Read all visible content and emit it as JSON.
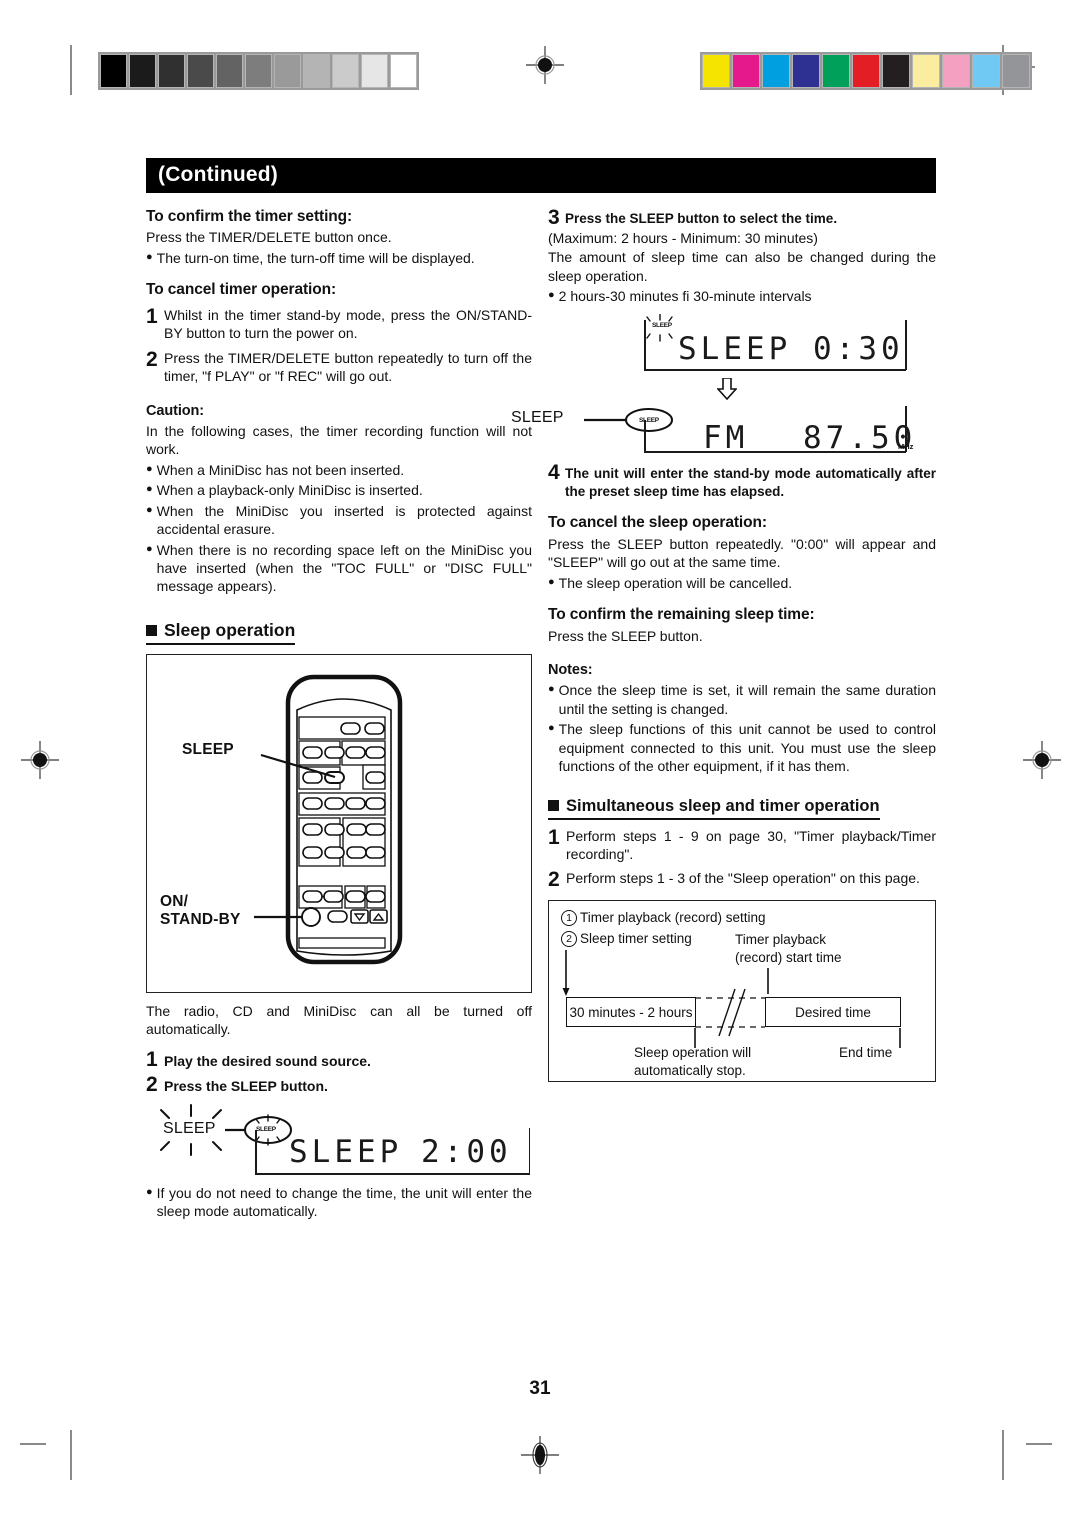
{
  "page": {
    "number": "31",
    "title": "(Continued)"
  },
  "printer_marks": {
    "grayscale_steps": [
      "#000000",
      "#1b1b1b",
      "#303030",
      "#4a4a4a",
      "#636363",
      "#7d7d7d",
      "#9a9a9a",
      "#b4b4b4",
      "#cbcbcb",
      "#e6e6e6",
      "#ffffff"
    ],
    "color_steps": [
      "#f5e400",
      "#e5198c",
      "#00a0e0",
      "#2e3192",
      "#00a05a",
      "#e31e24",
      "#231f20",
      "#faeda0",
      "#f4a0c0",
      "#6fc9f2",
      "#939598"
    ]
  },
  "left": {
    "confirm_timer": {
      "heading": "To confirm the timer setting:",
      "line1": "Press the TIMER/DELETE button once.",
      "bullet1": "The turn-on time, the turn-off time will be displayed."
    },
    "cancel_timer": {
      "heading": "To cancel timer operation:",
      "steps": [
        {
          "num": "1",
          "text": "Whilst in the timer stand-by mode, press the ON/STAND-BY button to turn the power on."
        },
        {
          "num": "2",
          "text": "Press the TIMER/DELETE button repeatedly to turn off the timer, \"f  PLAY\" or \"f  REC\" will go out."
        }
      ]
    },
    "caution": {
      "heading": "Caution:",
      "intro": "In the following cases, the timer recording function will not work.",
      "bullets": [
        "When a MiniDisc has not been inserted.",
        "When a playback-only MiniDisc is inserted.",
        "When the MiniDisc you inserted is protected against accidental erasure.",
        "When there is no recording space left on the MiniDisc you have inserted (when the \"TOC FULL\" or \"DISC FULL\" message appears)."
      ]
    },
    "sleep_section": {
      "heading": "Sleep operation",
      "remote_labels": {
        "sleep": "SLEEP",
        "on_standby_line1": "ON/",
        "on_standby_line2": "STAND-BY"
      },
      "intro": "The radio, CD and MiniDisc can all be turned off automatically.",
      "steps": [
        {
          "num": "1",
          "text": "Play the desired sound source."
        },
        {
          "num": "2",
          "text": "Press the SLEEP button."
        }
      ],
      "display": {
        "indicator_label": "SLEEP",
        "indicator_badge": "SLEEP",
        "segment_text": "SLEEP",
        "segment_value": "2:00"
      },
      "bullet_after": "If you do not need to change the time, the unit will enter the sleep mode automatically."
    }
  },
  "right": {
    "step3": {
      "num": "3",
      "heading": "Press the SLEEP button to select the time.",
      "line1": "(Maximum: 2 hours - Minimum: 30 minutes)",
      "line2": "The amount of sleep time can also be changed during the sleep operation.",
      "bullet": "2 hours-30 minutes fi  30-minute intervals"
    },
    "display_sleep": {
      "indicator_badge": "SLEEP",
      "segment_text": "SLEEP",
      "segment_value": "0:30"
    },
    "display_fm": {
      "indicator_label": "SLEEP",
      "indicator_badge": "SLEEP",
      "segment_text": "FM",
      "segment_value": "87.50",
      "unit": "MHz"
    },
    "step4": {
      "num": "4",
      "text": "The unit will enter the stand-by mode automatically after the preset sleep time has elapsed."
    },
    "cancel_sleep": {
      "heading": "To cancel the sleep operation:",
      "line1": "Press the SLEEP button repeatedly. \"0:00\" will appear and \"SLEEP\" will go out at the same time.",
      "bullet": "The sleep operation will be cancelled."
    },
    "confirm_sleep": {
      "heading": "To confirm the remaining sleep time:",
      "line1": "Press the SLEEP button."
    },
    "notes": {
      "heading": "Notes:",
      "bullets": [
        "Once the sleep time is set, it will remain the same duration until the setting is changed.",
        "The sleep functions of this unit cannot be used to control equipment connected to this unit. You must use the sleep functions of the other equipment, if it has them."
      ]
    },
    "simultaneous": {
      "heading": "Simultaneous sleep and timer operation",
      "steps": [
        {
          "num": "1",
          "text": "Perform steps 1 - 9 on page 30, \"Timer playback/Timer recording\"."
        },
        {
          "num": "2",
          "text": "Perform steps 1 - 3 of the \"Sleep operation\" on this page."
        }
      ],
      "diagram": {
        "item1_num": "1",
        "item1": "Timer playback (record) setting",
        "item2_num": "2",
        "item2": "Sleep timer setting",
        "start_label_line1": "Timer playback",
        "start_label_line2": "(record) start time",
        "left_box": "30 minutes - 2 hours",
        "right_box": "Desired time",
        "stop_label_line1": "Sleep operation will",
        "stop_label_line2": "automatically stop.",
        "end_label": "End time"
      }
    }
  }
}
